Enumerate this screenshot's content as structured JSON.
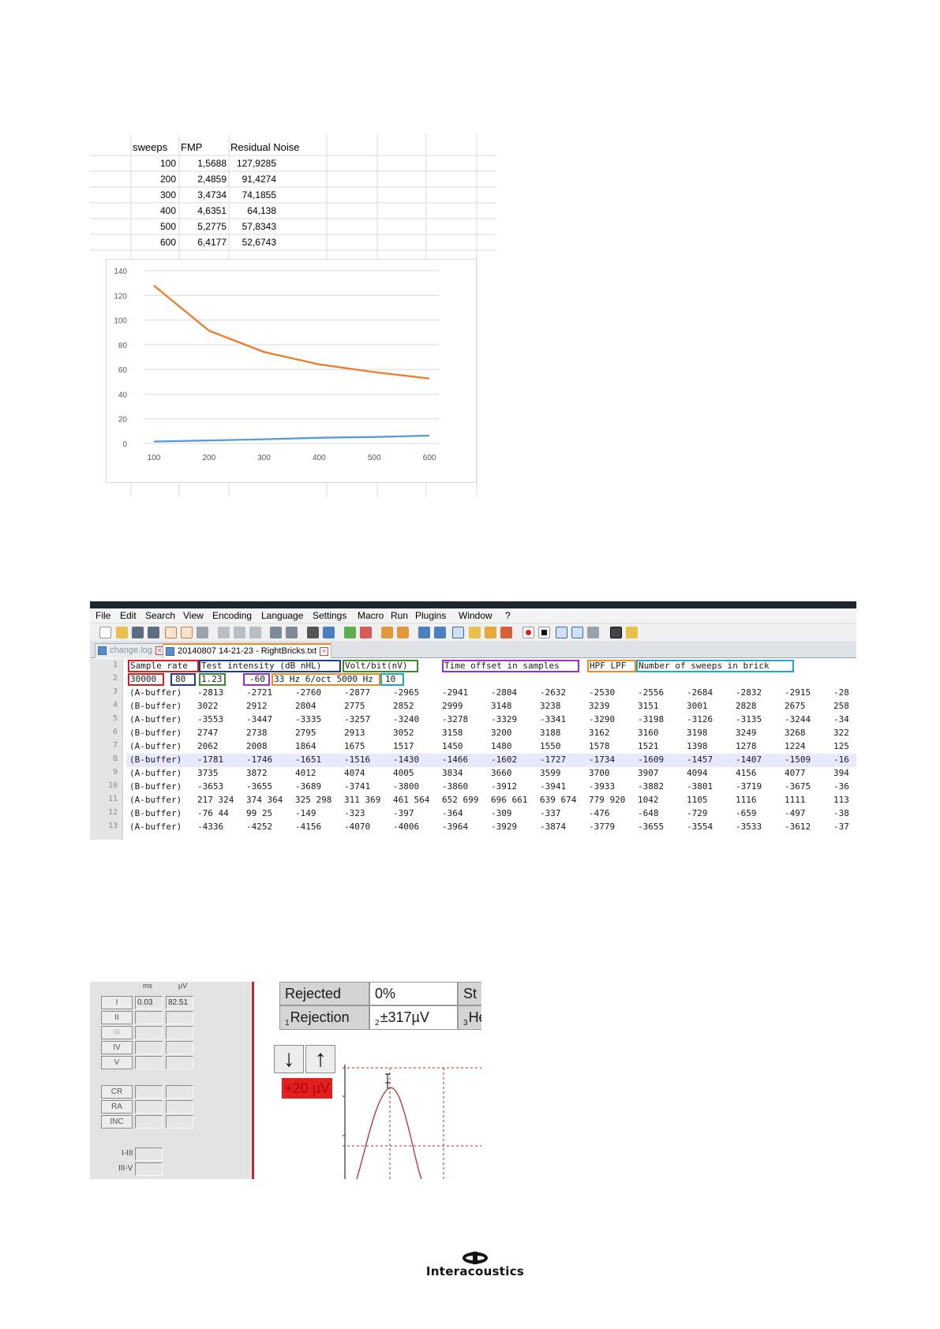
{
  "spreadsheet": {
    "headers": [
      "sweeps",
      "FMP",
      "Residual Noise"
    ],
    "rows": [
      [
        "100",
        "1,5688",
        "127,9285"
      ],
      [
        "200",
        "2,4859",
        "91,4274"
      ],
      [
        "300",
        "3,4734",
        "74,1855"
      ],
      [
        "400",
        "4,6351",
        "64,138"
      ],
      [
        "500",
        "5,2775",
        "57,8343"
      ],
      [
        "600",
        "6,4177",
        "52,6743"
      ]
    ]
  },
  "chart_data": {
    "type": "line",
    "x": [
      100,
      200,
      300,
      400,
      500,
      600
    ],
    "series": [
      {
        "values": [
          1.5688,
          2.4859,
          3.4734,
          4.6351,
          5.2775,
          6.4177
        ],
        "color": "#5b9bd5"
      },
      {
        "values": [
          127.9285,
          91.4274,
          74.1855,
          64.138,
          57.8343,
          52.6743
        ],
        "color": "#ed7d31"
      }
    ],
    "x_ticks": [
      "100",
      "200",
      "300",
      "400",
      "500",
      "600"
    ],
    "y_ticks": [
      "0",
      "20",
      "40",
      "60",
      "80",
      "100",
      "120",
      "140"
    ],
    "ylim": [
      0,
      140
    ],
    "grid": "horizontal",
    "title": "",
    "xlabel": "",
    "ylabel": ""
  },
  "notepad": {
    "title": "",
    "menu": [
      "File",
      "Edit",
      "Search",
      "View",
      "Encoding",
      "Language",
      "Settings",
      "Macro",
      "Run",
      "Plugins",
      "Window",
      "?"
    ],
    "tabs": [
      {
        "label": "change.log",
        "active": false
      },
      {
        "label": "20140807 14-21-23 - RightBricks.txt",
        "active": true
      }
    ],
    "header_fields": [
      {
        "text": "Sample rate",
        "color": "#d42020"
      },
      {
        "text": "Test intensity (dB nHL)",
        "color": "#1f3a93"
      },
      {
        "text": "Volt/bit(nV)",
        "color": "#3a8a2a"
      },
      {
        "text": "Time offset in samples",
        "color": "#9b30c8"
      },
      {
        "text": "HPF LPF",
        "color": "#f08a24"
      },
      {
        "text": "Number of sweeps in brick",
        "color": "#20a8c8"
      }
    ],
    "value_fields": [
      {
        "text": "30000",
        "color": "#d42020"
      },
      {
        "text": "80",
        "color": "#1f3a93"
      },
      {
        "text": "1.23",
        "color": "#3a8a2a"
      },
      {
        "text": "-60",
        "color": "#9b30c8"
      },
      {
        "text": "33 Hz 6/oct 5000 Hz",
        "color": "#f08a24"
      },
      {
        "text": "10",
        "color": "#20a8c8"
      }
    ],
    "line_numbers": [
      "1",
      "2",
      "3",
      "4",
      "5",
      "6",
      "7",
      "8",
      "9",
      "10",
      "11",
      "12",
      "13"
    ],
    "data_rows": [
      {
        "label": "(A-buffer)",
        "values": [
          "-2813",
          "-2721",
          "-2760",
          "-2877",
          "-2965",
          "-2941",
          "-2804",
          "-2632",
          "-2530",
          "-2556",
          "-2684",
          "-2832",
          "-2915",
          "-28"
        ]
      },
      {
        "label": "(B-buffer)",
        "values": [
          "3022",
          "2912",
          "2804",
          "2775",
          "2852",
          "2999",
          "3148",
          "3238",
          "3239",
          "3151",
          "3001",
          "2828",
          "2675",
          "258"
        ]
      },
      {
        "label": "(A-buffer)",
        "values": [
          "-3553",
          "-3447",
          "-3335",
          "-3257",
          "-3240",
          "-3278",
          "-3329",
          "-3341",
          "-3290",
          "-3198",
          "-3126",
          "-3135",
          "-3244",
          "-34"
        ]
      },
      {
        "label": "(B-buffer)",
        "values": [
          "2747",
          "2738",
          "2795",
          "2913",
          "3052",
          "3158",
          "3200",
          "3188",
          "3162",
          "3160",
          "3198",
          "3249",
          "3268",
          "322"
        ]
      },
      {
        "label": "(A-buffer)",
        "values": [
          "2062",
          "2008",
          "1864",
          "1675",
          "1517",
          "1450",
          "1480",
          "1550",
          "1578",
          "1521",
          "1398",
          "1278",
          "1224",
          "125"
        ]
      },
      {
        "label": "(B-buffer)",
        "values": [
          "-1781",
          "-1746",
          "-1651",
          "-1516",
          "-1430",
          "-1466",
          "-1602",
          "-1727",
          "-1734",
          "-1609",
          "-1457",
          "-1407",
          "-1509",
          "-16"
        ]
      },
      {
        "label": "(A-buffer)",
        "values": [
          "3735",
          "3872",
          "4012",
          "4074",
          "4005",
          "3834",
          "3660",
          "3599",
          "3700",
          "3907",
          "4094",
          "4156",
          "4077",
          "394"
        ]
      },
      {
        "label": "(B-buffer)",
        "values": [
          "-3653",
          "-3655",
          "-3689",
          "-3741",
          "-3800",
          "-3860",
          "-3912",
          "-3941",
          "-3933",
          "-3882",
          "-3801",
          "-3719",
          "-3675",
          "-36"
        ]
      },
      {
        "label": "(A-buffer)",
        "values": [
          "217 324",
          "374 364",
          "325 298",
          "311 369",
          "461 564",
          "652 699",
          "696 661",
          "639 674",
          "779 920",
          "1042",
          "1105",
          "1116",
          "1111",
          "113"
        ]
      },
      {
        "label": "(B-buffer)",
        "values": [
          "-76 44",
          "99 25",
          "-149",
          "-323",
          "-397",
          "-364",
          "-309",
          "-337",
          "-476",
          "-648",
          "-729",
          "-659",
          "-497",
          "-38"
        ]
      },
      {
        "label": "(A-buffer)",
        "values": [
          "-4336",
          "-4252",
          "-4156",
          "-4070",
          "-4006",
          "-3964",
          "-3929",
          "-3874",
          "-3779",
          "-3655",
          "-3554",
          "-3533",
          "-3612",
          "-37"
        ]
      }
    ]
  },
  "measure_panel": {
    "col_headers": [
      "ms",
      "µV"
    ],
    "peaks": [
      "I",
      "II",
      "III",
      "IV",
      "V"
    ],
    "peak_I_values": [
      "0.03",
      "82.51"
    ],
    "ratio_buttons": [
      "CR",
      "RA",
      "INC"
    ],
    "interval_labels": [
      "I-III",
      "III-V"
    ],
    "info_rows": [
      {
        "index": "",
        "label": "Rejected",
        "value_index": "",
        "value": "0%",
        "right_index": "",
        "right": "St"
      },
      {
        "index": "1",
        "label": "Rejection",
        "value_index": "2",
        "value": "±317µV",
        "right_index": "3",
        "right": "He"
      }
    ],
    "arrows": [
      "↓",
      "↑"
    ],
    "scale_label": "+20 µV",
    "accent_red": "#c0262d"
  },
  "logo": {
    "text": "Interacoustics"
  }
}
